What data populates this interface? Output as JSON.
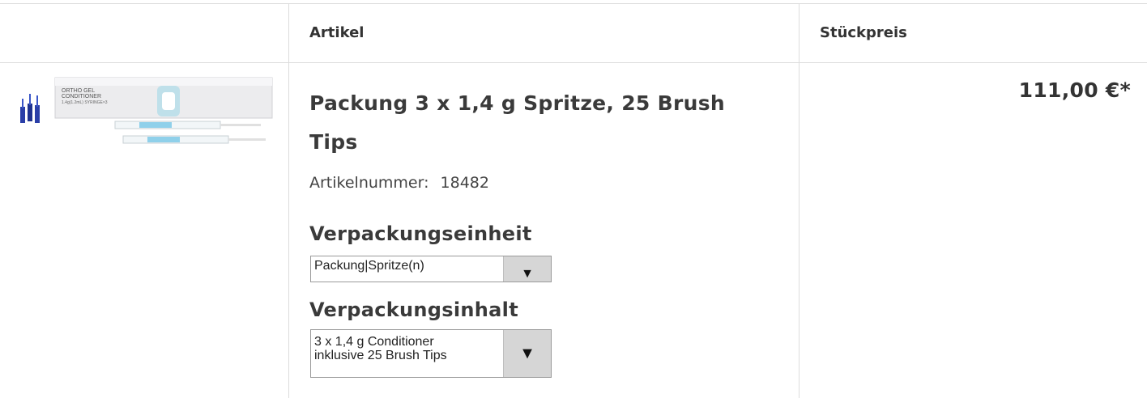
{
  "table": {
    "headers": {
      "image": "",
      "article": "Artikel",
      "unit_price": "Stückpreis"
    }
  },
  "product": {
    "title": "Packung 3 x 1,4 g Spritze, 25 Brush Tips",
    "article_number_label": "Artikelnummer:",
    "article_number": "18482",
    "packaging_unit_label": "Verpackungseinheit",
    "packaging_unit_value": "Packung|Spritze(n)",
    "packaging_content_label": "Verpackungsinhalt",
    "packaging_content_value": "3 x 1,4 g Conditioner\ninklusive 25 Brush Tips",
    "price": "111,00 €*",
    "image_text": {
      "line1": "ORTHO GEL",
      "line2": "CONDITIONER",
      "line3": "1.4g(1.2mL) SYRINGE×3"
    }
  },
  "icons": {
    "dropdown_arrow": "▼"
  },
  "colors": {
    "border": "#dcdcdc",
    "text": "#333333",
    "select_button": "#d6d6d6"
  }
}
